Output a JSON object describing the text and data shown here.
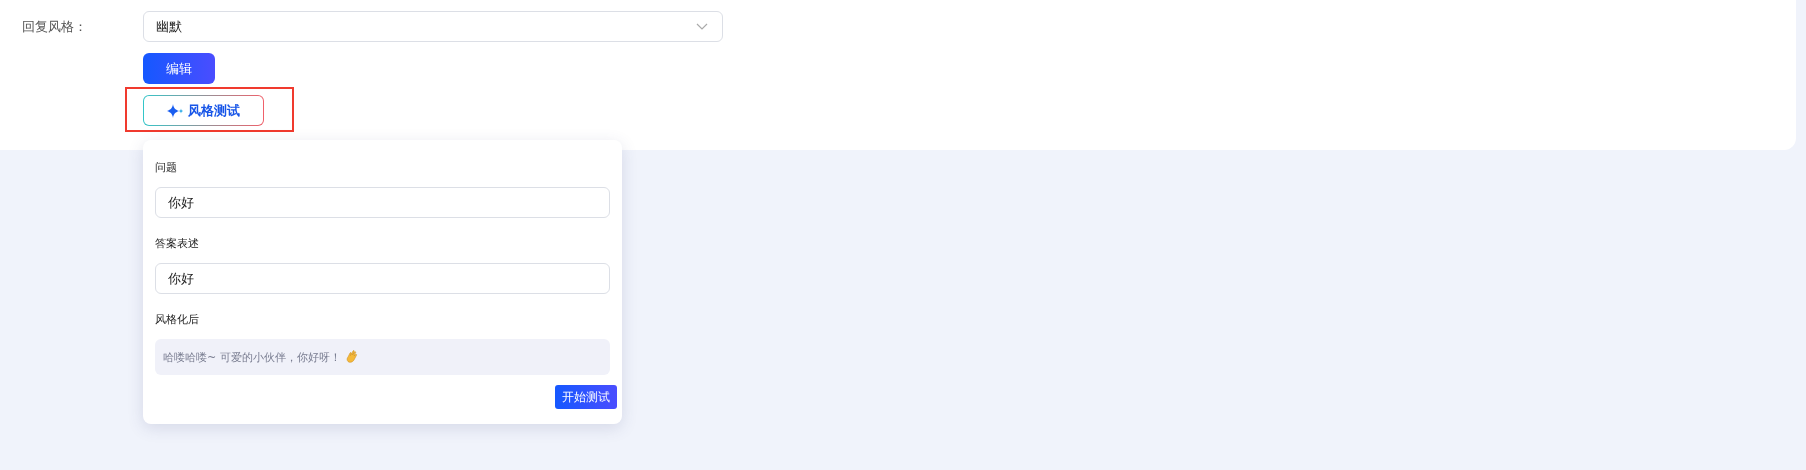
{
  "form": {
    "label": "回复风格：",
    "select": {
      "value": "幽默"
    },
    "edit_button": "编辑",
    "test_button": {
      "label": "风格测试",
      "highlighted": true
    }
  },
  "popover": {
    "fields": [
      {
        "kind": "input",
        "label": "问题",
        "value": "你好"
      },
      {
        "kind": "input",
        "label": "答案表述",
        "value": "你好"
      },
      {
        "kind": "output",
        "label": "风格化后",
        "value": "哈喽哈喽~ 可爱的小伙伴，你好呀！"
      }
    ],
    "start_button": "开始测试"
  }
}
